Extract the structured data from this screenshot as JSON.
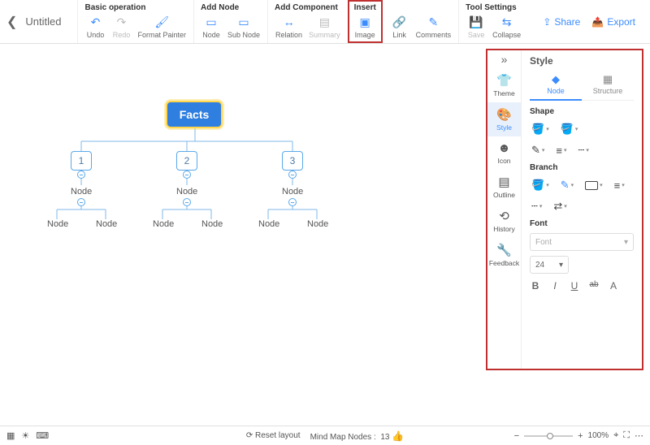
{
  "doc": {
    "title": "Untitled"
  },
  "toolbar": {
    "groups": {
      "basic": {
        "title": "Basic operation",
        "undo": "Undo",
        "redo": "Redo",
        "format_painter": "Format Painter"
      },
      "add_node": {
        "title": "Add Node",
        "node": "Node",
        "sub_node": "Sub Node"
      },
      "add_component": {
        "title": "Add Component",
        "relation": "Relation",
        "summary": "Summary"
      },
      "insert": {
        "title": "Insert",
        "image": "Image",
        "link": "Link",
        "comments": "Comments"
      },
      "tool_settings": {
        "title": "Tool Settings",
        "save": "Save",
        "collapse": "Collapse"
      }
    },
    "share": "Share",
    "export": "Export"
  },
  "mindmap": {
    "root": "Facts",
    "children": [
      {
        "num": "1",
        "node": "Node",
        "leaves": [
          "Node",
          "Node"
        ]
      },
      {
        "num": "2",
        "node": "Node",
        "leaves": [
          "Node",
          "Node"
        ]
      },
      {
        "num": "3",
        "node": "Node",
        "leaves": [
          "Node",
          "Node"
        ]
      }
    ]
  },
  "panel": {
    "title": "Style",
    "left_tabs": {
      "theme": "Theme",
      "style": "Style",
      "icon": "Icon",
      "outline": "Outline",
      "history": "History",
      "feedback": "Feedback"
    },
    "right_tabs": {
      "node": "Node",
      "structure": "Structure"
    },
    "sections": {
      "shape": "Shape",
      "branch": "Branch",
      "font": "Font"
    },
    "font": {
      "placeholder": "Font",
      "size": "24"
    }
  },
  "bottom": {
    "reset": "Reset layout",
    "nodes_label": "Mind Map Nodes :",
    "nodes_count": "13",
    "zoom": "100%"
  }
}
